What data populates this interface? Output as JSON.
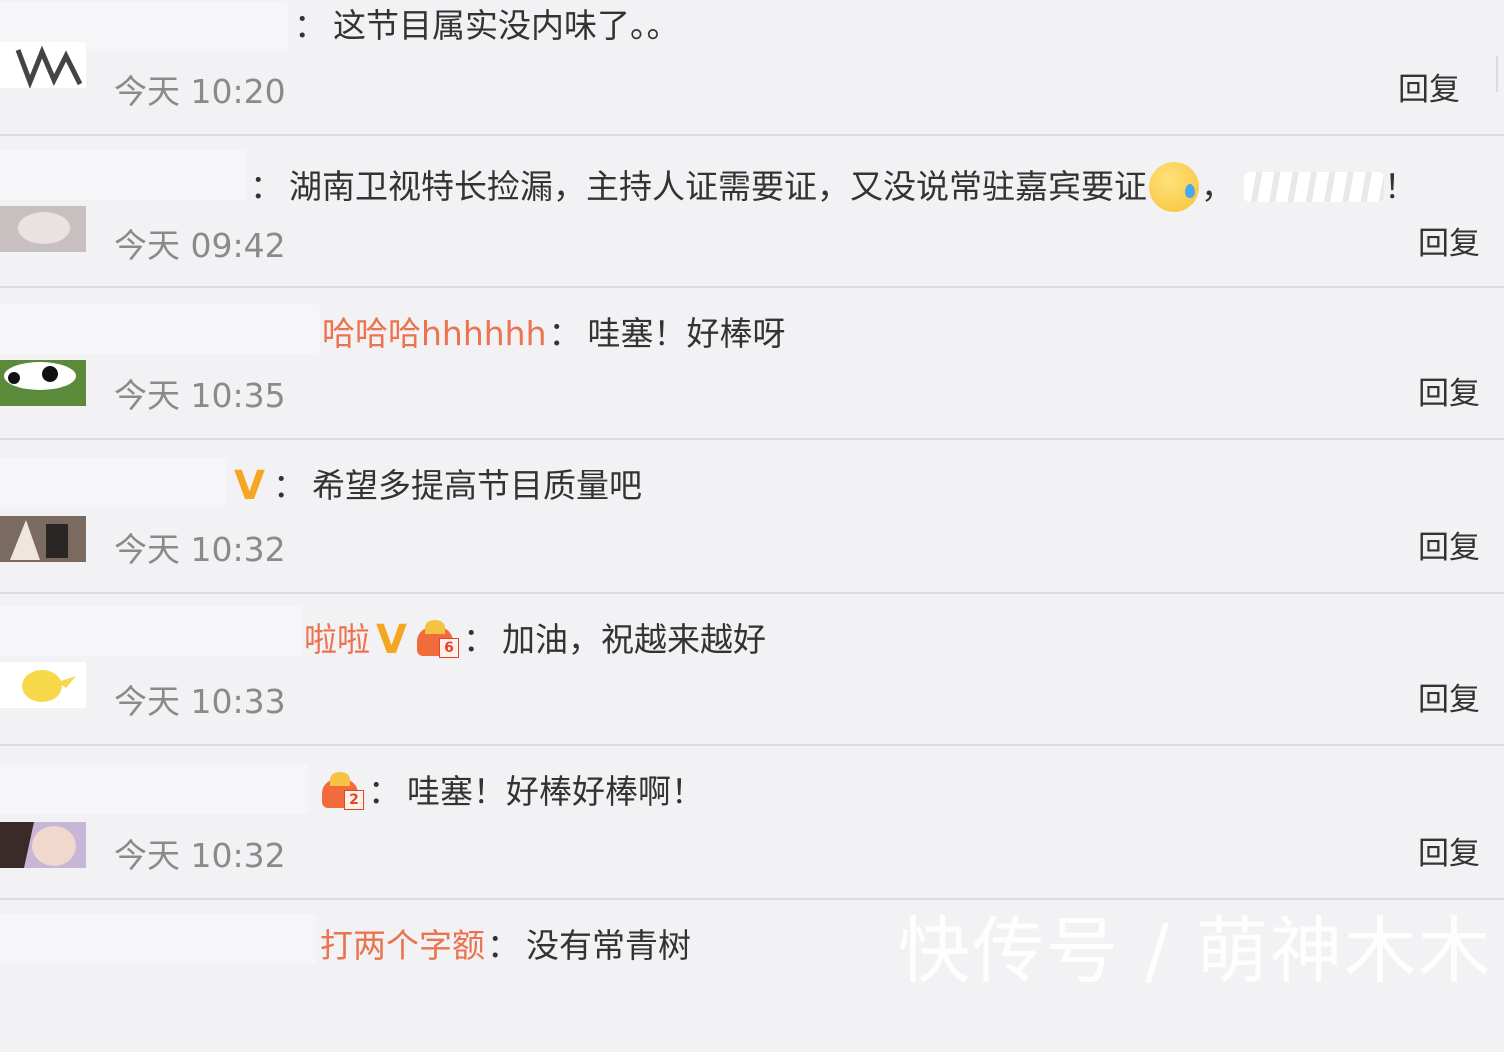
{
  "comments": [
    {
      "username": "",
      "text": "这节目属实没内味了。。",
      "time": "今天 10:20",
      "reply": "回复"
    },
    {
      "username": "",
      "text_before": "湖南卫视特长捡漏，主持人证需要证，又没说常驻嘉宾要证",
      "text_after": "，",
      "time": "今天 09:42",
      "reply": "回复",
      "trailing_punct": "！"
    },
    {
      "username": "哈哈哈hhhhhh",
      "text": "哇塞！好棒呀",
      "time": "今天 10:35",
      "reply": "回复"
    },
    {
      "username": "",
      "text": "希望多提高节目质量吧",
      "time": "今天 10:32",
      "reply": "回复",
      "badge": "V"
    },
    {
      "username": "啦啦",
      "text": "加油，祝越来越好",
      "time": "今天 10:33",
      "reply": "回复",
      "badge": "V",
      "vip_level": "6"
    },
    {
      "username": "",
      "text": "哇塞！好棒好棒啊！",
      "time": "今天 10:32",
      "reply": "回复",
      "vip_level": "2"
    },
    {
      "username": "打两个字额",
      "text": "没有常青树"
    }
  ],
  "colon": "：",
  "watermark": "快传号 / 萌神木木",
  "colors": {
    "username": "#eb7350",
    "badge": "#f5a623",
    "background": "#f2f2f5",
    "time": "#8a8a8a"
  },
  "icons": [
    "avatar-image",
    "verified-v-icon",
    "vip-crown-icon",
    "cold-sweat-emoji"
  ]
}
